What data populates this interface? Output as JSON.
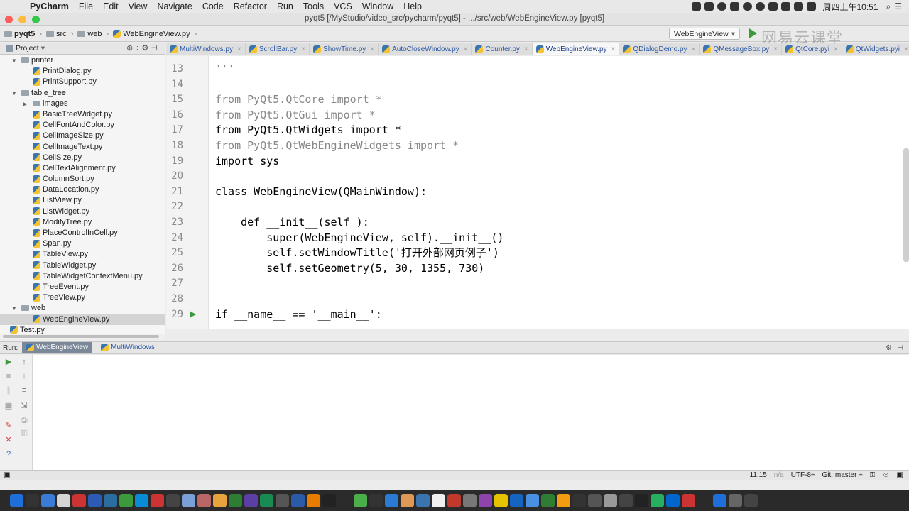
{
  "menubar": {
    "app": "PyCharm",
    "items": [
      "File",
      "Edit",
      "View",
      "Navigate",
      "Code",
      "Refactor",
      "Run",
      "Tools",
      "VCS",
      "Window",
      "Help"
    ],
    "clock": "周四上午10:51"
  },
  "window": {
    "title": "pyqt5 [/MyStudio/video_src/pycharm/pyqt5] - .../src/web/WebEngineView.py [pyqt5]"
  },
  "breadcrumb": [
    "pyqt5",
    "src",
    "web",
    "WebEngineView.py"
  ],
  "run_config": "WebEngineView",
  "watermark": "网易云课堂",
  "project_panel": {
    "title": "Project",
    "tree": [
      {
        "label": "printer",
        "level": 3,
        "type": "folder",
        "expanded": true
      },
      {
        "label": "PrintDialog.py",
        "level": 4,
        "type": "py"
      },
      {
        "label": "PrintSupport.py",
        "level": 4,
        "type": "py"
      },
      {
        "label": "table_tree",
        "level": 3,
        "type": "folder",
        "expanded": true
      },
      {
        "label": "images",
        "level": 4,
        "type": "folder",
        "expanded": false
      },
      {
        "label": "BasicTreeWidget.py",
        "level": 4,
        "type": "py"
      },
      {
        "label": "CellFontAndColor.py",
        "level": 4,
        "type": "py"
      },
      {
        "label": "CellImageSize.py",
        "level": 4,
        "type": "py"
      },
      {
        "label": "CellImageText.py",
        "level": 4,
        "type": "py"
      },
      {
        "label": "CellSize.py",
        "level": 4,
        "type": "py"
      },
      {
        "label": "CellTextAlignment.py",
        "level": 4,
        "type": "py"
      },
      {
        "label": "ColumnSort.py",
        "level": 4,
        "type": "py"
      },
      {
        "label": "DataLocation.py",
        "level": 4,
        "type": "py"
      },
      {
        "label": "ListView.py",
        "level": 4,
        "type": "py"
      },
      {
        "label": "ListWidget.py",
        "level": 4,
        "type": "py"
      },
      {
        "label": "ModifyTree.py",
        "level": 4,
        "type": "py"
      },
      {
        "label": "PlaceControlInCell.py",
        "level": 4,
        "type": "py"
      },
      {
        "label": "Span.py",
        "level": 4,
        "type": "py"
      },
      {
        "label": "TableView.py",
        "level": 4,
        "type": "py"
      },
      {
        "label": "TableWidget.py",
        "level": 4,
        "type": "py"
      },
      {
        "label": "TableWidgetContextMenu.py",
        "level": 4,
        "type": "py"
      },
      {
        "label": "TreeEvent.py",
        "level": 4,
        "type": "py"
      },
      {
        "label": "TreeView.py",
        "level": 4,
        "type": "py"
      },
      {
        "label": "web",
        "level": 3,
        "type": "folder",
        "expanded": true
      },
      {
        "label": "WebEngineView.py",
        "level": 4,
        "type": "py",
        "selected": true
      },
      {
        "label": "Test.py",
        "level": 2,
        "type": "py"
      }
    ]
  },
  "tabs": [
    {
      "label": "MultiWindows.py"
    },
    {
      "label": "ScrollBar.py"
    },
    {
      "label": "ShowTime.py"
    },
    {
      "label": "AutoCloseWindow.py"
    },
    {
      "label": "Counter.py"
    },
    {
      "label": "WebEngineView.py",
      "active": true
    },
    {
      "label": "QDialogDemo.py"
    },
    {
      "label": "QMessageBox.py"
    },
    {
      "label": "QtCore.pyi"
    },
    {
      "label": "QtWidgets.pyi"
    }
  ],
  "code_lines": [
    {
      "n": "13",
      "text": "'''"
    },
    {
      "n": "14",
      "text": ""
    },
    {
      "n": "15",
      "text": "from PyQt5.QtCore import *"
    },
    {
      "n": "16",
      "text": "from PyQt5.QtGui import *"
    },
    {
      "n": "17",
      "text": "from PyQt5.QtWidgets import *"
    },
    {
      "n": "18",
      "text": "from PyQt5.QtWebEngineWidgets import *"
    },
    {
      "n": "19",
      "text": "import sys"
    },
    {
      "n": "20",
      "text": ""
    },
    {
      "n": "21",
      "text": "class WebEngineView(QMainWindow):"
    },
    {
      "n": "22",
      "text": ""
    },
    {
      "n": "23",
      "text": "    def __init__(self ):"
    },
    {
      "n": "24",
      "text": "        super(WebEngineView, self).__init__()"
    },
    {
      "n": "25",
      "text": "        self.setWindowTitle('打开外部网页例子')"
    },
    {
      "n": "26",
      "text": "        self.setGeometry(5, 30, 1355, 730)"
    },
    {
      "n": "27",
      "text": ""
    },
    {
      "n": "28",
      "text": ""
    },
    {
      "n": "29",
      "text": "if __name__ == '__main__':"
    }
  ],
  "run_panel": {
    "label": "Run:",
    "tabs": [
      "WebEngineView",
      "MultiWindows"
    ]
  },
  "status": {
    "position": "11:15",
    "na": "n/a",
    "encoding": "UTF-8÷",
    "git": "Git: master ÷"
  },
  "colors": {
    "selection": "#d4d4d4",
    "keyword": "#000080",
    "string": "#067d17",
    "number": "#1750eb",
    "self": "#94558d",
    "run_green": "#3c9a3c"
  }
}
